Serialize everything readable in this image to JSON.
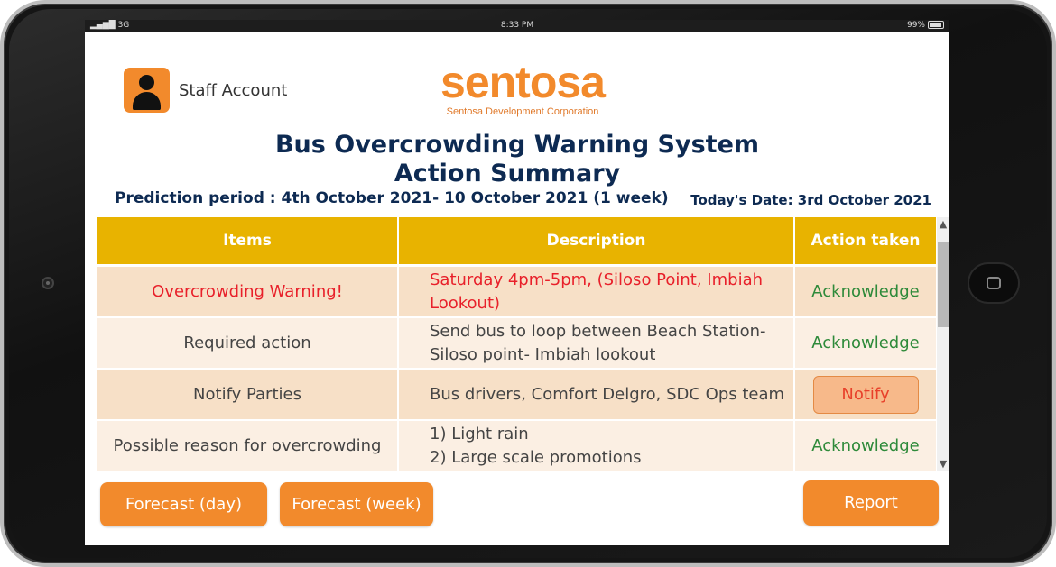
{
  "status_bar": {
    "signal": "3G",
    "time": "8:33 PM",
    "battery": "99%"
  },
  "account": {
    "label": "Staff Account"
  },
  "logo": {
    "name": "sentosa",
    "subtitle": "Sentosa Development Corporation"
  },
  "header": {
    "title": "Bus Overcrowding Warning System",
    "subtitle": "Action Summary",
    "prediction_period": "Prediction period : 4th October 2021- 10 October 2021 (1 week)",
    "today_date": "Today's Date: 3rd October 2021"
  },
  "table": {
    "columns": [
      "Items",
      "Description",
      "Action taken"
    ],
    "rows": [
      {
        "item": "Overcrowding Warning!",
        "description_line1": "Saturday 4pm-5pm, (Siloso Point, Imbiah",
        "description_line2": "Lookout)",
        "action": "Acknowledge"
      },
      {
        "item": "Required action",
        "description_line1": "Send bus to loop between Beach Station-",
        "description_line2": "Siloso point- Imbiah lookout",
        "action": "Acknowledge"
      },
      {
        "item": "Notify Parties",
        "description_line1": "Bus drivers, Comfort Delgro, SDC Ops team",
        "description_line2": "",
        "action": "Notify"
      },
      {
        "item": "Possible reason for overcrowding",
        "description_line1": "1) Light rain",
        "description_line2": "2) Large scale promotions",
        "action": "Acknowledge"
      }
    ]
  },
  "buttons": {
    "forecast_day": "Forecast (day)",
    "forecast_week": "Forecast (week)",
    "report": "Report"
  },
  "colors": {
    "accent": "#f28a2c",
    "header_bg": "#e8b300",
    "title": "#0d2a52",
    "ack": "#2e8a3a",
    "warning": "#e8202a"
  }
}
